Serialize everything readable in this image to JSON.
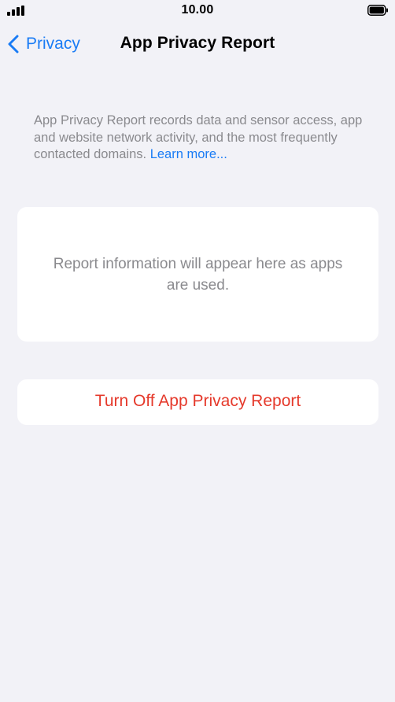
{
  "status_bar": {
    "time": "10.00"
  },
  "nav": {
    "back_label": "Privacy",
    "title": "App Privacy Report"
  },
  "description": {
    "text": "App Privacy Report records data and sensor access, app and website network activity, and the most frequently contacted domains.",
    "link_label": "Learn more..."
  },
  "report": {
    "empty_message": "Report information will appear here as apps are used."
  },
  "actions": {
    "turn_off_label": "Turn Off App Privacy Report"
  },
  "colors": {
    "background": "#f2f2f7",
    "accent": "#1a7cf5",
    "destructive": "#e5392b",
    "secondary_text": "#8a8a8e"
  },
  "icons": {
    "back": "chevron-left-icon",
    "signal": "cellular-signal-icon",
    "battery": "battery-icon"
  }
}
